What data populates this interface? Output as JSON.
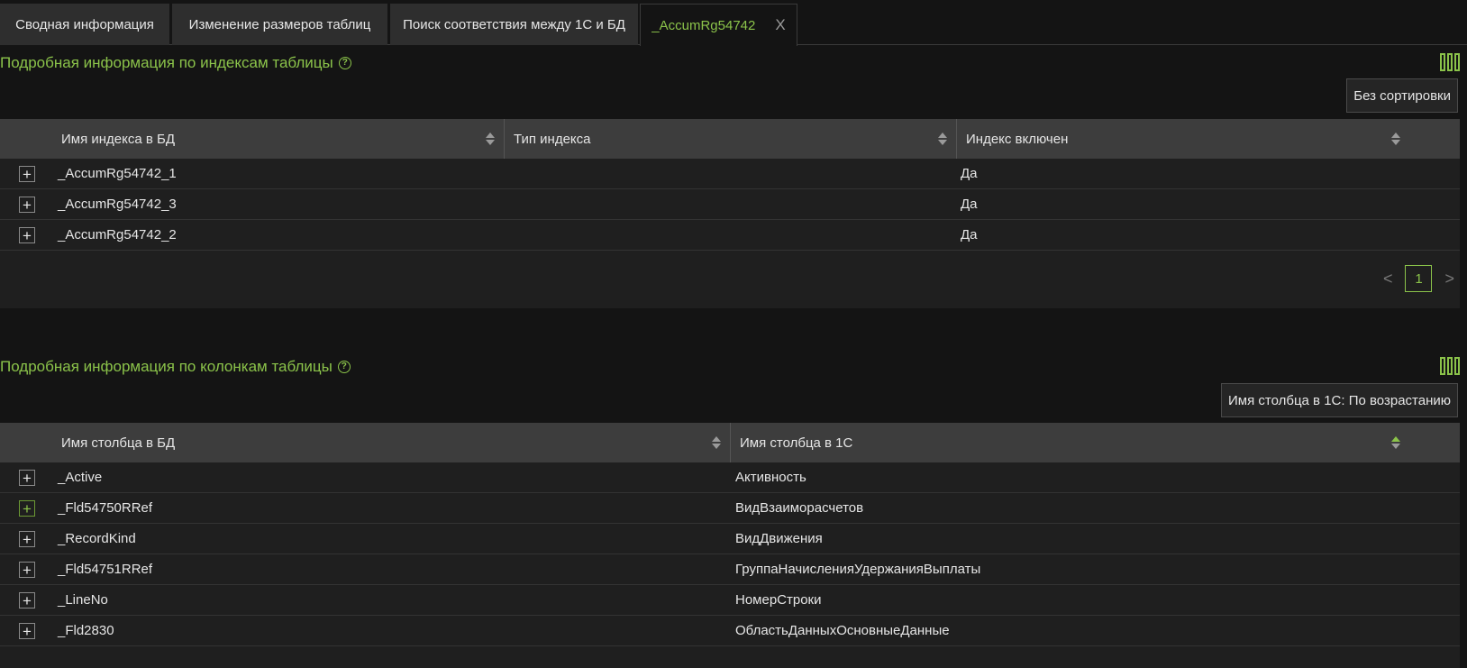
{
  "tabs": [
    {
      "label": "Сводная информация"
    },
    {
      "label": "Изменение размеров таблиц"
    },
    {
      "label": "Поиск соответствия между 1С и БД"
    },
    {
      "label": "_AccumRg54742",
      "close": "X"
    }
  ],
  "indexes": {
    "title": "Подробная информация по индексам таблицы",
    "help": "?",
    "sort_label": "Без сортировки",
    "headers": [
      "Имя индекса в БД",
      "Тип индекса",
      "Индекс включен"
    ],
    "rows": [
      {
        "expand": "+",
        "name": "_AccumRg54742_1",
        "type": "",
        "enabled": "Да"
      },
      {
        "expand": "+",
        "name": "_AccumRg54742_3",
        "type": "",
        "enabled": "Да"
      },
      {
        "expand": "+",
        "name": "_AccumRg54742_2",
        "type": "",
        "enabled": "Да"
      }
    ],
    "pager": {
      "prev": "<",
      "page": "1",
      "next": ">"
    }
  },
  "columns": {
    "title": "Подробная информация по колонкам таблицы",
    "help": "?",
    "sort_label": "Имя столбца в 1С: По возрастанию",
    "headers": [
      "Имя столбца в БД",
      "Имя столбца в 1С"
    ],
    "rows": [
      {
        "expand": "+",
        "db": "_Active",
        "onec": "Активность"
      },
      {
        "expand": "+",
        "db": "_Fld54750RRef",
        "onec": "ВидВзаиморасчетов"
      },
      {
        "expand": "+",
        "db": "_RecordKind",
        "onec": "ВидДвижения"
      },
      {
        "expand": "+",
        "db": "_Fld54751RRef",
        "onec": "ГруппаНачисленияУдержанияВыплаты"
      },
      {
        "expand": "+",
        "db": "_LineNo",
        "onec": "НомерСтроки"
      },
      {
        "expand": "+",
        "db": "_Fld2830",
        "onec": "ОбластьДанныхОсновныеДанные"
      }
    ]
  },
  "colors": {
    "accent": "#8bc34a",
    "background": "#141414",
    "header": "#3d3d3d",
    "tab": "#2e2e2e"
  }
}
